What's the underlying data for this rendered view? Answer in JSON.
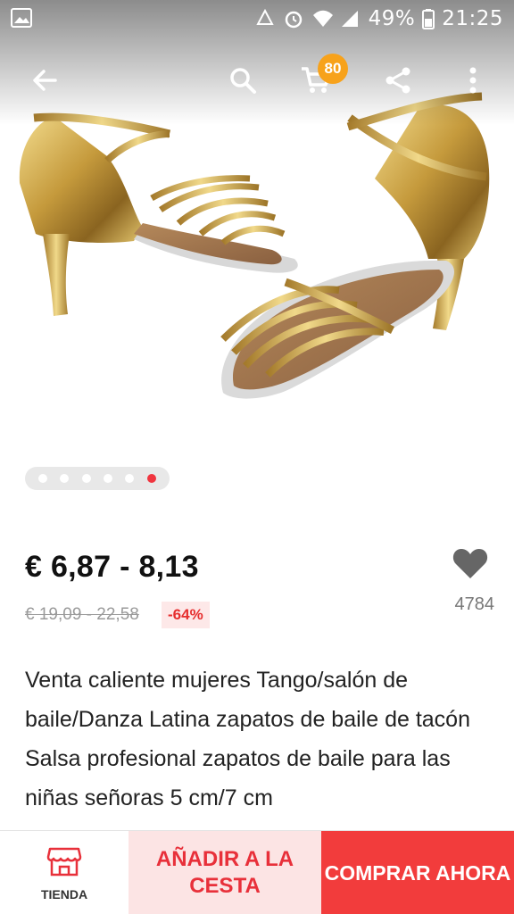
{
  "status_bar": {
    "battery_percent": "49%",
    "time": "21:25",
    "icons": [
      "image-notification-icon",
      "recycle-icon",
      "alarm-icon",
      "wifi-icon",
      "signal-icon",
      "battery-icon"
    ]
  },
  "top_bar": {
    "icons": [
      "back-arrow-icon",
      "search-icon",
      "cart-icon",
      "share-icon",
      "more-vert-icon"
    ],
    "cart_badge": "80"
  },
  "gallery": {
    "image_count": 6,
    "active_index": 5
  },
  "product": {
    "price": "€ 6,87 - 8,13",
    "old_price": "€ 19,09 - 22,58",
    "discount": "-64%",
    "wishlist_count": "4784",
    "title": "Venta caliente mujeres Tango/salón de baile/Danza Latina zapatos de baile de tacón Salsa profesional zapatos de baile para las niñas señoras 5 cm/7 cm"
  },
  "bottom_bar": {
    "store_label": "TIENDA",
    "add_to_cart": "AÑADIR A LA CESTA",
    "buy_now": "COMPRAR AHORA"
  },
  "colors": {
    "accent": "#f23c3c",
    "badge": "#f7a21b",
    "cart_bg": "#fce4e4",
    "gold": "#c9a54a"
  }
}
